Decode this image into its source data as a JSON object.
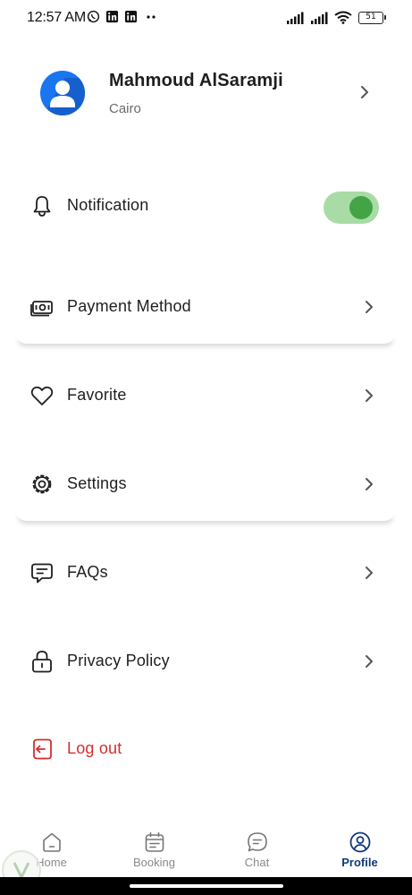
{
  "status_bar": {
    "time": "12:57 AM",
    "battery": "51",
    "icons": [
      "whatsapp-icon",
      "linkedin-icon",
      "linkedin-icon",
      "more-dots-icon",
      "signal-icon",
      "signal-icon",
      "wifi-icon",
      "battery-icon"
    ]
  },
  "profile": {
    "name": "Mahmoud AlSaramji",
    "city": "Cairo",
    "avatar_color": "#1976f0"
  },
  "menu": {
    "notification": {
      "label": "Notification",
      "icon": "bell-icon",
      "toggle_on": true,
      "toggle_color": "#43a446"
    },
    "payment": {
      "label": "Payment Method",
      "icon": "cash-icon"
    },
    "favorite": {
      "label": "Favorite",
      "icon": "heart-icon"
    },
    "settings": {
      "label": "Settings",
      "icon": "gear-icon"
    },
    "faqs": {
      "label": "FAQs",
      "icon": "chat-bubble-icon"
    },
    "privacy": {
      "label": "Privacy Policy",
      "icon": "lock-icon"
    },
    "logout": {
      "label": "Log out",
      "icon": "logout-icon",
      "color": "#d32f2f"
    }
  },
  "bottom_nav": {
    "items": [
      {
        "label": "Home",
        "icon": "home-icon",
        "active": false
      },
      {
        "label": "Booking",
        "icon": "calendar-icon",
        "active": false
      },
      {
        "label": "Chat",
        "icon": "chat-icon",
        "active": false
      },
      {
        "label": "Profile",
        "icon": "profile-icon",
        "active": true
      }
    ],
    "active_color": "#123a78",
    "inactive_color": "#8a8a8a"
  }
}
